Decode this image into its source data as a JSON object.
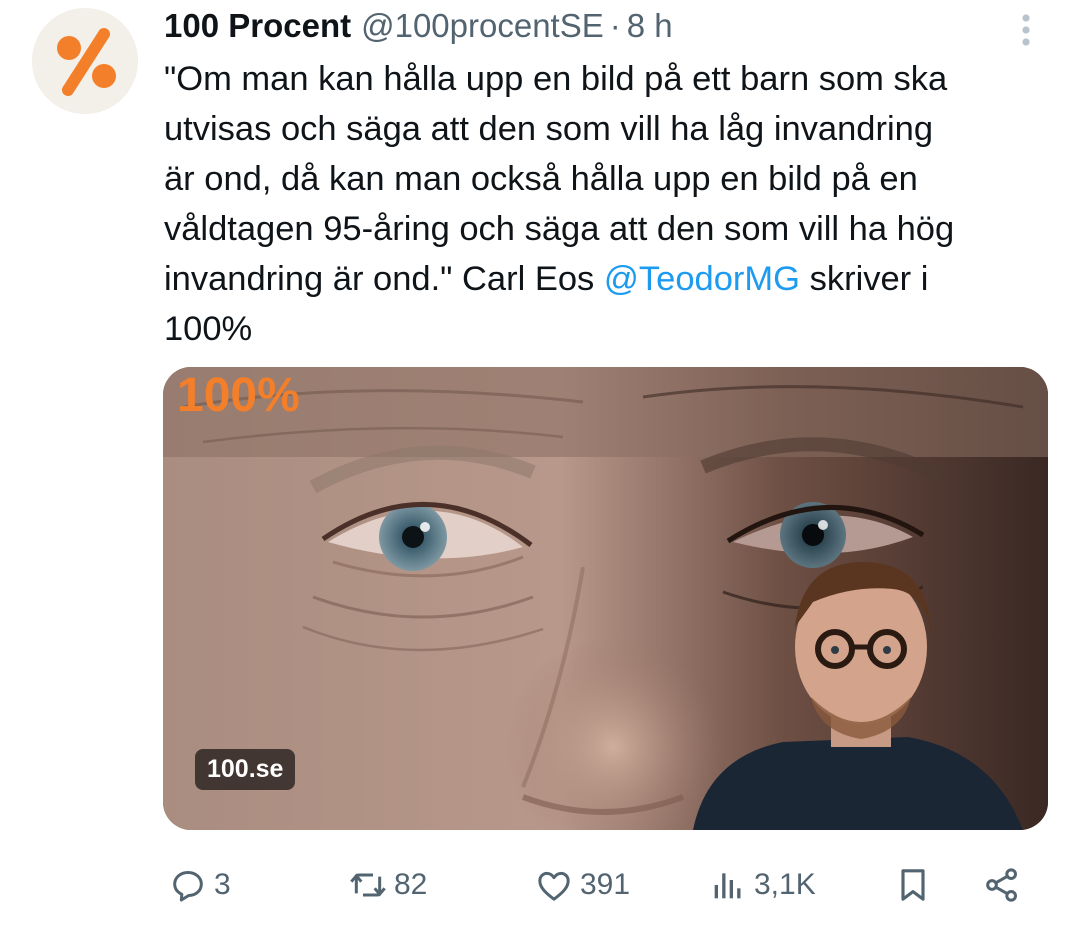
{
  "tweet": {
    "author_name": "100 Procent",
    "author_handle": "@100procentSE",
    "separator": "·",
    "time": "8 h",
    "text_main": "\"Om man kan hålla upp en bild på ett barn som ska\nutvisas och säga att den som vill ha låg invandring\när ond, då kan man också hålla upp en bild på en\nvåldtagen 95-åring och säga att den som vill ha hög\ninvandring är ond.\" Carl Eos ",
    "mention": "@TeodorMG",
    "text_end": " skriver i\n100%",
    "media": {
      "site_badge": "100.se",
      "logo_text": "100%"
    },
    "actions": {
      "replies": "3",
      "reposts": "82",
      "likes": "391",
      "views": "3,1K"
    }
  },
  "colors": {
    "brand_orange": "#f47f2a",
    "link_blue": "#1d9bf0",
    "muted_gray": "#536471"
  },
  "icons": [
    "avatar-percent-logo",
    "more-vertical-icon",
    "reply-icon",
    "repost-icon",
    "like-icon",
    "views-icon",
    "bookmark-icon",
    "share-icon"
  ]
}
